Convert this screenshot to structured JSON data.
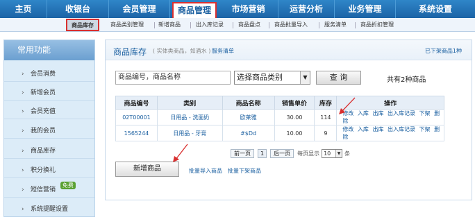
{
  "topnav": [
    {
      "label": "主页"
    },
    {
      "label": "收银台"
    },
    {
      "label": "会员管理"
    },
    {
      "label": "商品管理",
      "active": true
    },
    {
      "label": "市场营销"
    },
    {
      "label": "运营分析"
    },
    {
      "label": "业务管理"
    },
    {
      "label": "系统设置"
    }
  ],
  "subnav": [
    {
      "label": "商品库存",
      "active": true
    },
    {
      "label": "商品类别管理"
    },
    {
      "label": "新增商品"
    },
    {
      "label": "出入库记录"
    },
    {
      "label": "商品盘点"
    },
    {
      "label": "商品批量导入"
    },
    {
      "label": "服务清单"
    },
    {
      "label": "商品折扣管理"
    }
  ],
  "sidebar": {
    "title": "常用功能",
    "items": [
      {
        "label": "会员消费"
      },
      {
        "label": "新增会员"
      },
      {
        "label": "会员充值"
      },
      {
        "label": "我的会员"
      },
      {
        "label": "商品库存"
      },
      {
        "label": "积分换礼"
      },
      {
        "label": "短信营销",
        "badge": "免费"
      },
      {
        "label": "系统提醒设置"
      }
    ]
  },
  "main": {
    "title": "商品库存",
    "note": "( 实体类商品，如酒水 )",
    "service_link": "服务清单",
    "offshelf_link": "已下架商品1种",
    "search_value": "商品编号，商品名称",
    "category_select": "选择商品类别",
    "query_button": "查 询",
    "total_text": "共有2种商品",
    "table": {
      "headers": [
        "商品编号",
        "类别",
        "商品名称",
        "销售单价",
        "库存",
        "操作"
      ],
      "rows": [
        {
          "code": "02T00001",
          "category": "日用品 - 洗面奶",
          "name": "欧莱雅",
          "price": "30.00",
          "stock": "114",
          "ops": [
            "修改",
            "入库",
            "出库",
            "出入库记录",
            "下架",
            "删除"
          ]
        },
        {
          "code": "1565244",
          "category": "日用品 - 牙膏",
          "name": "#$Dd",
          "price": "10.00",
          "stock": "9",
          "ops": [
            "修改",
            "入库",
            "出库",
            "出入库记录",
            "下架",
            "删除"
          ]
        }
      ]
    },
    "pager": {
      "prev": "前一页",
      "current": "1",
      "next": "后一页",
      "per_page_label": "每页显示",
      "per_page_value": "10",
      "unit": "条"
    },
    "add_button": "新增商品",
    "bulk_import_link": "批量导入商品",
    "bulk_offshelf_link": "批量下架商品"
  },
  "colors": {
    "nav_blue": "#1b63a6",
    "highlight_red": "#d93030",
    "link_blue": "#1a5fa0"
  }
}
